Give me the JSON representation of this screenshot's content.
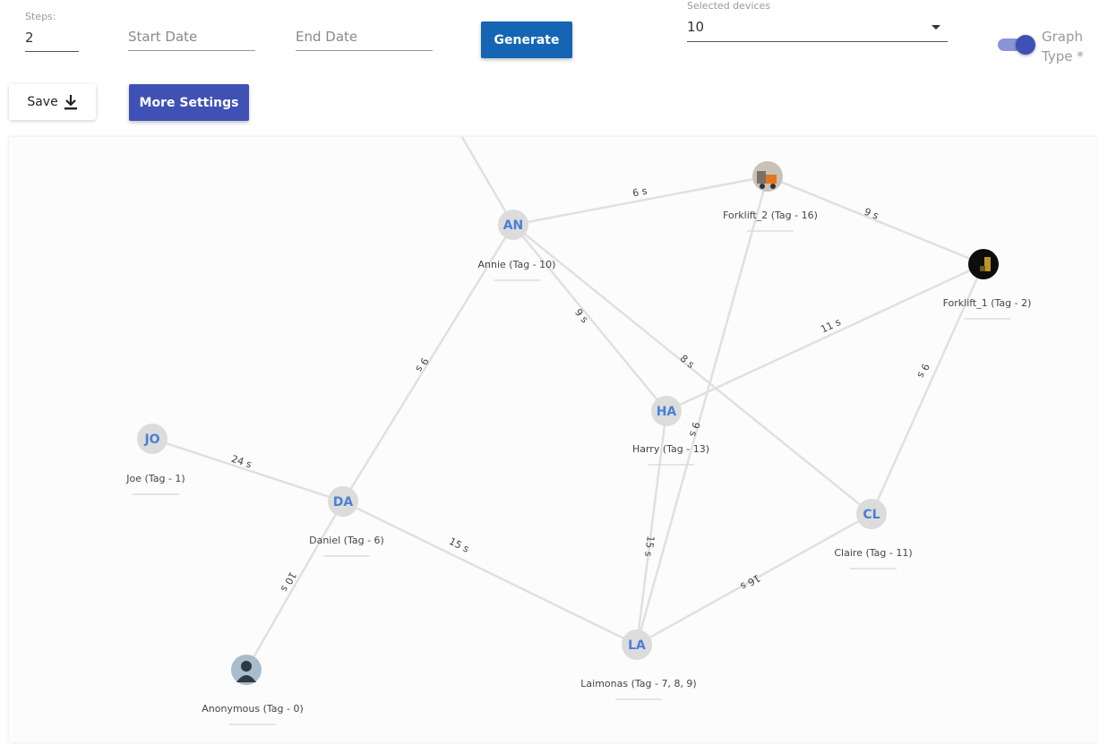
{
  "controls": {
    "steps_label": "Steps:",
    "steps_value": "2",
    "start_date_placeholder": "Start Date",
    "end_date_placeholder": "End Date",
    "generate_label": "Generate",
    "devices_label": "Selected devices",
    "devices_value": "10",
    "graph_type_label": "Graph Type *",
    "save_label": "Save",
    "more_settings_label": "More Settings"
  },
  "graph": {
    "nodes": [
      {
        "id": "AN",
        "initials": "AN",
        "label": "Annie (Tag - 10)",
        "kind": "initials"
      },
      {
        "id": "F2",
        "initials": "",
        "label": "Forklift_2 (Tag - 16)",
        "kind": "forklift-photo"
      },
      {
        "id": "F1",
        "initials": "",
        "label": "Forklift_1 (Tag - 2)",
        "kind": "forklift-photo-dark"
      },
      {
        "id": "HA",
        "initials": "HA",
        "label": "Harry (Tag - 13)",
        "kind": "initials"
      },
      {
        "id": "JO",
        "initials": "JO",
        "label": "Joe (Tag - 1)",
        "kind": "initials"
      },
      {
        "id": "DA",
        "initials": "DA",
        "label": "Daniel (Tag - 6)",
        "kind": "initials"
      },
      {
        "id": "CL",
        "initials": "CL",
        "label": "Claire (Tag - 11)",
        "kind": "initials"
      },
      {
        "id": "LA",
        "initials": "LA",
        "label": "Laimonas (Tag - 7, 8, 9)",
        "kind": "initials"
      },
      {
        "id": "ANON",
        "initials": "",
        "label": "Anonymous (Tag - 0)",
        "kind": "avatar"
      }
    ],
    "edges": [
      {
        "from": "OFF",
        "to": "AN",
        "label": ""
      },
      {
        "from": "AN",
        "to": "F2",
        "label": "6 s"
      },
      {
        "from": "F2",
        "to": "F1",
        "label": "9 s"
      },
      {
        "from": "AN",
        "to": "HA",
        "label": "9 s"
      },
      {
        "from": "AN",
        "to": "CL",
        "label": "8 s"
      },
      {
        "from": "AN",
        "to": "DA",
        "label": "9 s"
      },
      {
        "from": "F2",
        "to": "LA",
        "label": "9 s"
      },
      {
        "from": "HA",
        "to": "F1",
        "label": "11 s"
      },
      {
        "from": "F1",
        "to": "CL",
        "label": "9 s"
      },
      {
        "from": "HA",
        "to": "LA",
        "label": "15 s"
      },
      {
        "from": "JO",
        "to": "DA",
        "label": "24 s"
      },
      {
        "from": "DA",
        "to": "LA",
        "label": "15 s"
      },
      {
        "from": "DA",
        "to": "ANON",
        "label": "10 s"
      },
      {
        "from": "CL",
        "to": "LA",
        "label": "16 s"
      }
    ]
  }
}
